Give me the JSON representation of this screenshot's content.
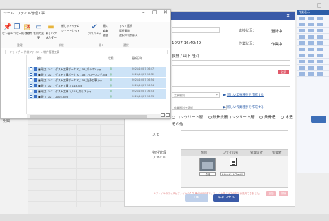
{
  "background": {
    "left_labels": [
      "詳細",
      "明細"
    ],
    "right_header": "作業表示",
    "primary_color": "#3b5ba8"
  },
  "modal": {
    "fields": {
      "date_value": "10/27 16:49:49",
      "progress_label": "進捗状況：",
      "progress_value": "過計中",
      "work_label": "作業状況：",
      "work_value": "作業中",
      "person": "長野 / 山下 隆斗",
      "red_label": "必須",
      "select1": "工事種別",
      "link1": "新しい工事種別を作成する",
      "select2": "作業種別を選択",
      "link2": "新しい作業種別を作成する",
      "radio_options": [
        "コンクリート層",
        "鉄骨鉄筋コンクリート層",
        "鉄骨造",
        "木造"
      ],
      "other": "その他",
      "memo_label": "メモ",
      "attach_label_1": "物件管理",
      "attach_label_2": "ファイル"
    },
    "attachments": {
      "headers": [
        "削除",
        "ファイル名",
        "管理設計",
        "登録者"
      ],
      "thumb_label": "写真",
      "file_label": "ドキュメントファイル"
    },
    "note": "※ファイルのサイズはファイルあたり最大10MBまで、ファイル名に以下の記号は使用できません。",
    "pink_buttons": [
      "追加",
      "削除"
    ],
    "ok_label": "OK",
    "cancel_label": "キャンセル"
  },
  "explorer": {
    "title": "ツール　ファイル管理工事",
    "controls": {
      "minimize": "–",
      "maximize": "□",
      "close": "✕"
    },
    "ribbon": {
      "pin": "ピン留め",
      "copy": "コピー",
      "paste": "貼り付け",
      "delete": "削除",
      "rename": "名前の変更",
      "new_folder": "新しいフォルダー",
      "new_item": "新しいアイテム",
      "shortcut": "ショートカット",
      "properties": "プロパティ",
      "open": "開く",
      "edit": "編集",
      "history": "履歴",
      "select_all": "すべて選択",
      "select_none": "選択解除",
      "invert": "選択の切り替え",
      "groups": [
        "整理",
        "新規",
        "開く",
        "選択"
      ]
    },
    "address": "ドライブ > 作業ファイル > 物件管理工事",
    "columns": {
      "name": "名前",
      "status": "状態",
      "date": "更新日時"
    },
    "files": [
      {
        "name": "■ 現工 K&T - ダスト工事ボーナス_118_ガラス2.jpg",
        "date": "2021/10/27 16:47"
      },
      {
        "name": "■ 現工 K&T - ダスト工事ボーナス_118_フローリング.jpg",
        "date": "2021/10/27 16:52"
      },
      {
        "name": "■ 現工 K&T - ダスト工事ボーナス_118_洗浄工事.jpg",
        "date": "2021/10/27 16:54"
      },
      {
        "name": "■ 現工 K&T - ダスト工事 3_118.jpg",
        "date": "2021/10/27 16:54"
      },
      {
        "name": "■ 現工 K&T - ダスト工事 3_118_ガラス.jpg",
        "date": "2021/10/27 16:53"
      },
      {
        "name": "■ 現工 K&T - 2005.jpeg",
        "date": "2021/10/27 16:53"
      }
    ]
  }
}
